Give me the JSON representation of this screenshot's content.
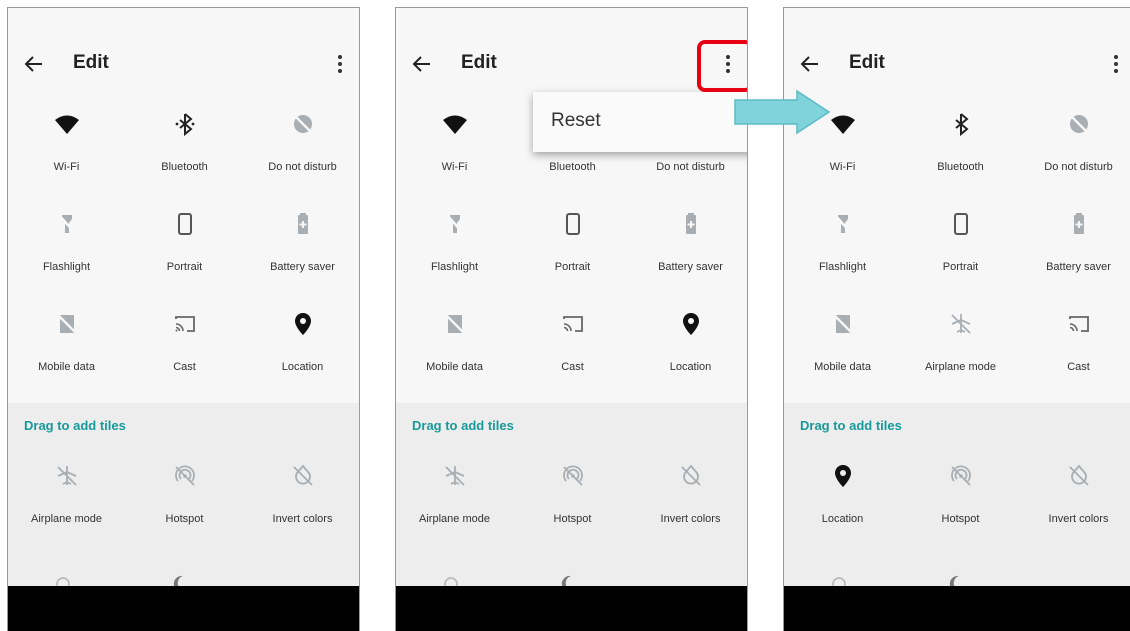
{
  "screens": [
    {
      "header": {
        "title": "Edit"
      },
      "tiles": [
        {
          "label": "Wi-Fi",
          "icon": "wifi-icon"
        },
        {
          "label": "Bluetooth",
          "icon": "bluetooth-icon"
        },
        {
          "label": "Do not disturb",
          "icon": "do-not-disturb-icon"
        },
        {
          "label": "Flashlight",
          "icon": "flashlight-icon"
        },
        {
          "label": "Portrait",
          "icon": "portrait-icon"
        },
        {
          "label": "Battery saver",
          "icon": "battery-saver-icon"
        },
        {
          "label": "Mobile data",
          "icon": "mobile-data-icon"
        },
        {
          "label": "Cast",
          "icon": "cast-icon"
        },
        {
          "label": "Location",
          "icon": "location-icon"
        }
      ],
      "add_section": {
        "label": "Drag to add tiles",
        "tiles": [
          {
            "label": "Airplane mode",
            "icon": "airplane-mode-icon"
          },
          {
            "label": "Hotspot",
            "icon": "hotspot-icon"
          },
          {
            "label": "Invert colors",
            "icon": "invert-colors-icon"
          }
        ]
      }
    },
    {
      "header": {
        "title": "Edit"
      },
      "menu": {
        "items": [
          "Reset"
        ]
      },
      "tiles": [
        {
          "label": "Wi-Fi",
          "icon": "wifi-icon"
        },
        {
          "label": "Bluetooth",
          "icon": "bluetooth-icon"
        },
        {
          "label": "Do not disturb",
          "icon": "do-not-disturb-icon"
        },
        {
          "label": "Flashlight",
          "icon": "flashlight-icon"
        },
        {
          "label": "Portrait",
          "icon": "portrait-icon"
        },
        {
          "label": "Battery saver",
          "icon": "battery-saver-icon"
        },
        {
          "label": "Mobile data",
          "icon": "mobile-data-icon"
        },
        {
          "label": "Cast",
          "icon": "cast-icon"
        },
        {
          "label": "Location",
          "icon": "location-icon"
        }
      ],
      "add_section": {
        "label": "Drag to add tiles",
        "tiles": [
          {
            "label": "Airplane mode",
            "icon": "airplane-mode-icon"
          },
          {
            "label": "Hotspot",
            "icon": "hotspot-icon"
          },
          {
            "label": "Invert colors",
            "icon": "invert-colors-icon"
          }
        ]
      }
    },
    {
      "header": {
        "title": "Edit"
      },
      "tiles": [
        {
          "label": "Wi-Fi",
          "icon": "wifi-icon"
        },
        {
          "label": "Bluetooth",
          "icon": "bluetooth-icon"
        },
        {
          "label": "Do not disturb",
          "icon": "do-not-disturb-icon"
        },
        {
          "label": "Flashlight",
          "icon": "flashlight-icon"
        },
        {
          "label": "Portrait",
          "icon": "portrait-icon"
        },
        {
          "label": "Battery saver",
          "icon": "battery-saver-icon"
        },
        {
          "label": "Mobile data",
          "icon": "mobile-data-icon"
        },
        {
          "label": "Airplane mode",
          "icon": "airplane-mode-icon"
        },
        {
          "label": "Cast",
          "icon": "cast-icon"
        }
      ],
      "add_section": {
        "label": "Drag to add tiles",
        "tiles": [
          {
            "label": "Location",
            "icon": "location-icon"
          },
          {
            "label": "Hotspot",
            "icon": "hotspot-icon"
          },
          {
            "label": "Invert colors",
            "icon": "invert-colors-icon"
          }
        ]
      }
    }
  ],
  "colors": {
    "accent": "#189a9a",
    "highlight": "#e60012",
    "arrow": "#7fd3da"
  }
}
